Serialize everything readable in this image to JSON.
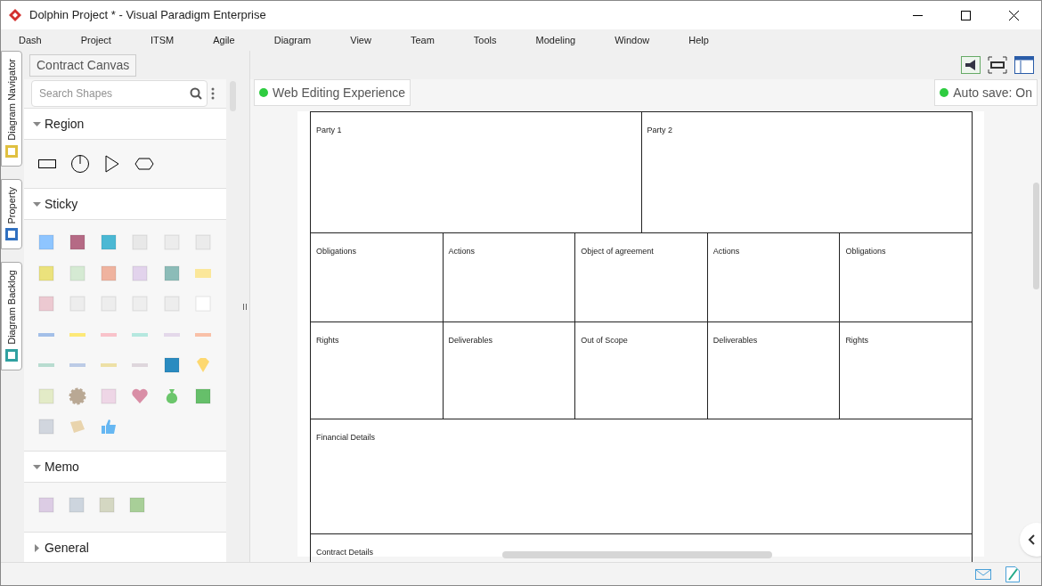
{
  "window": {
    "title": "Dolphin Project * - Visual Paradigm Enterprise"
  },
  "menu": [
    "Dash",
    "Project",
    "ITSM",
    "Agile",
    "Diagram",
    "View",
    "Team",
    "Tools",
    "Modeling",
    "Window",
    "Help"
  ],
  "side_tabs": [
    {
      "label": "Diagram Navigator",
      "selected": false
    },
    {
      "label": "Property",
      "selected": false
    },
    {
      "label": "Diagram Backlog",
      "selected": false
    }
  ],
  "breadcrumb": "Contract Canvas",
  "search": {
    "placeholder": "Search Shapes"
  },
  "palette": [
    {
      "title": "Region",
      "expanded": true,
      "kind": "region"
    },
    {
      "title": "Sticky",
      "expanded": true,
      "kind": "sticky"
    },
    {
      "title": "Memo",
      "expanded": true,
      "kind": "memo"
    },
    {
      "title": "General",
      "expanded": false,
      "kind": "none"
    }
  ],
  "badges": [
    {
      "label": "Web Editing Experience",
      "color": "#2ecc40"
    },
    {
      "label": "Auto save: On",
      "color": "#2ecc40"
    }
  ],
  "canvas": {
    "rows": [
      [
        "Party 1",
        "Party 2"
      ],
      [
        "Obligations",
        "Actions",
        "Object of agreement",
        "Actions",
        "Obligations"
      ],
      [
        "Rights",
        "Deliverables",
        "Out of Scope",
        "Deliverables",
        "Rights"
      ],
      [
        "Financial Details"
      ],
      [
        "Contract Details"
      ]
    ]
  }
}
